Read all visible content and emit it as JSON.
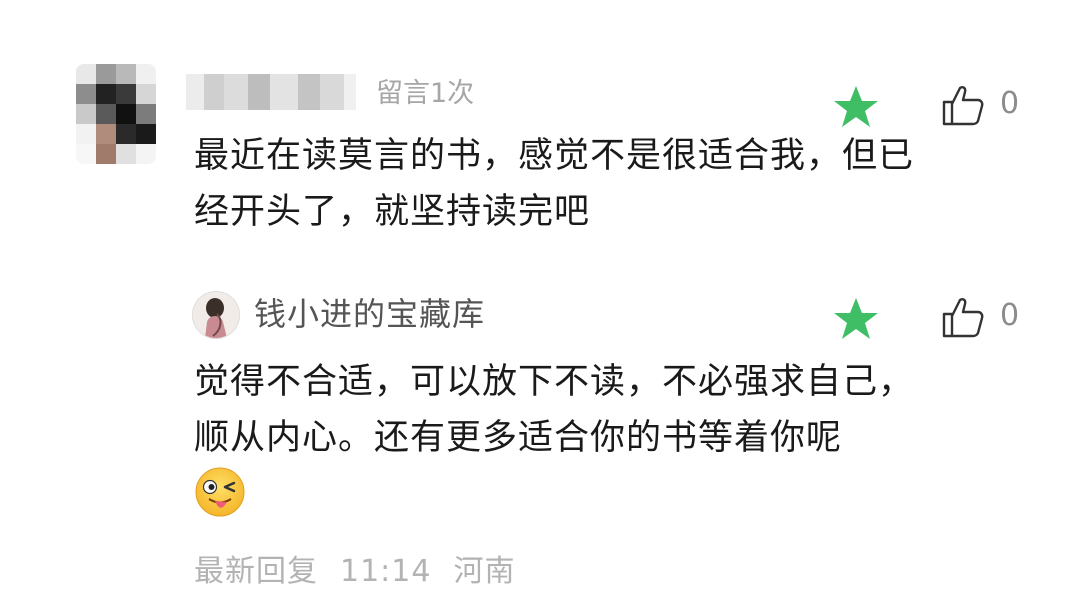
{
  "comment": {
    "username_obscured": true,
    "message_count_label": "留言1次",
    "text_line1": "最近在读莫言的书，感觉不是很适合我，但已",
    "text_line2": "经开头了，就坚持读完吧",
    "star_icon": "star-icon",
    "like_icon": "thumbs-up-icon",
    "like_count": "0",
    "star_color": "#3fbe66"
  },
  "reply": {
    "author": "钱小进的宝藏库",
    "text_line1": "觉得不合适，可以放下不读，不必强求自己，",
    "text_line2": "顺从内心。还有更多适合你的书等着你呢",
    "emoji_icon": "winking-tongue-emoji",
    "like_count": "0",
    "footer_label": "最新回复",
    "time": "11:14",
    "location": "河南"
  }
}
